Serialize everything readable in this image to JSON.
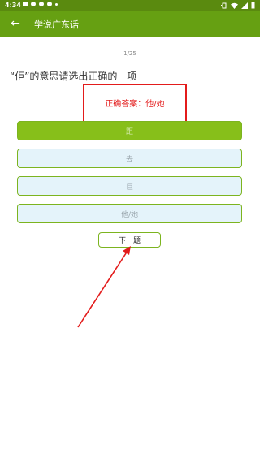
{
  "status_bar": {
    "time": "4:34"
  },
  "app_bar": {
    "back_icon": "arrow-left-icon",
    "back_glyph": "←",
    "title": "学说广东话"
  },
  "quiz": {
    "progress": "1/25",
    "question": "“佢”的意思请选出正确的一项",
    "answer_feedback": "正确答案：他/她",
    "options": [
      {
        "label": "距",
        "selected": true
      },
      {
        "label": "去",
        "selected": false
      },
      {
        "label": "巨",
        "selected": false
      },
      {
        "label": "他/她",
        "selected": false
      }
    ],
    "next_label": "下一题"
  },
  "colors": {
    "status_bar": "#5a8a0f",
    "app_bar": "#66a012",
    "annotation": "#e31b1b",
    "option_border": "#7cb41f",
    "option_bg": "#e4f3fa",
    "option_selected_bg": "#87bf1a"
  }
}
